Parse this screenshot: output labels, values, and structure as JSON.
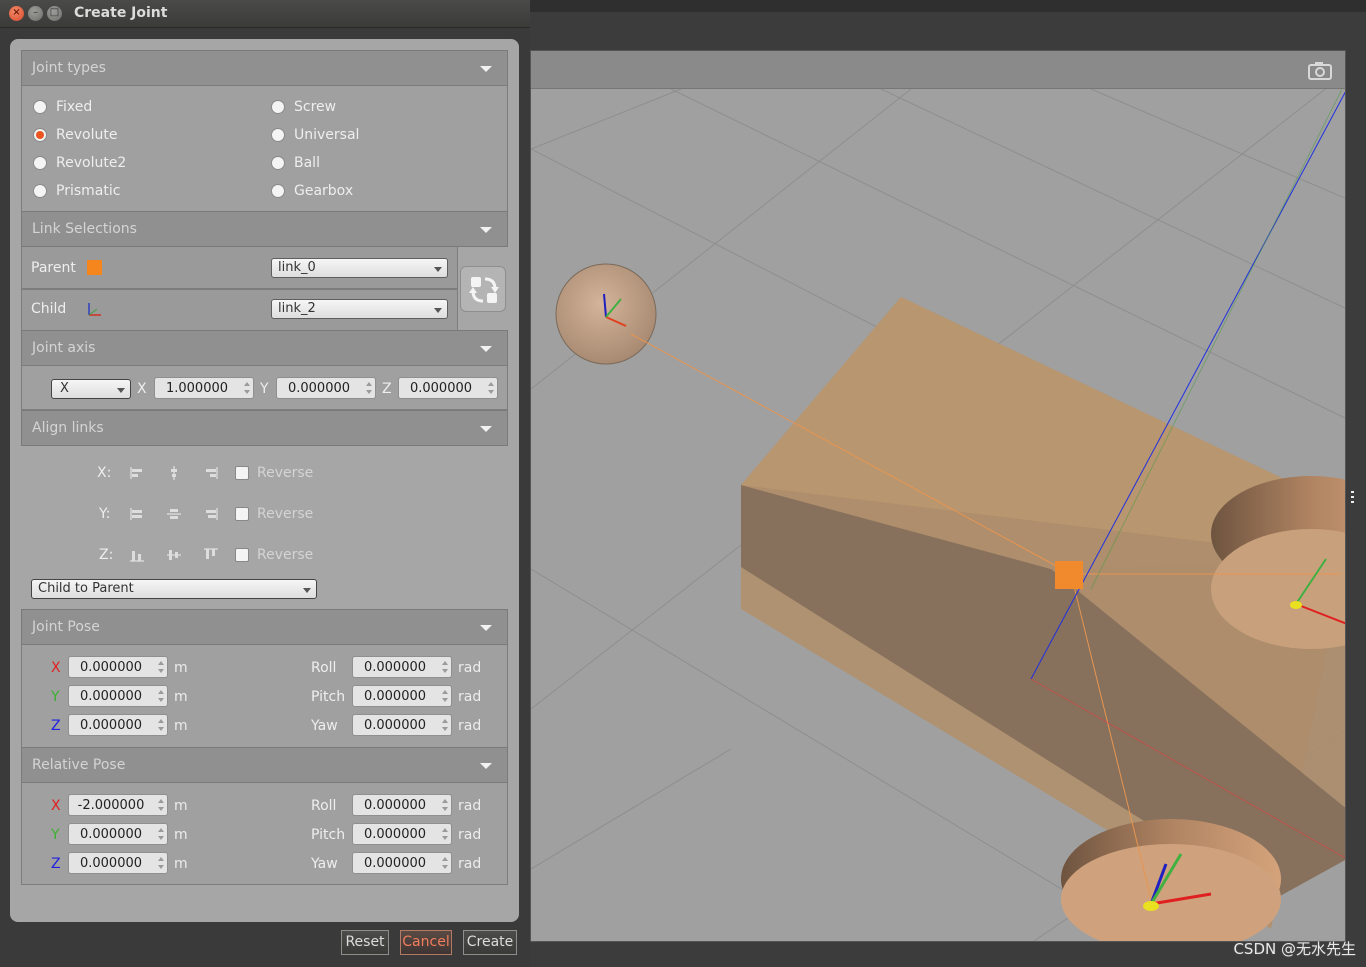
{
  "window": {
    "title": "Create Joint"
  },
  "sections": {
    "joint_types": "Joint types",
    "link_selections": "Link Selections",
    "joint_axis": "Joint axis",
    "align_links": "Align links",
    "joint_pose": "Joint Pose",
    "relative_pose": "Relative Pose"
  },
  "joint_types": [
    {
      "label": "Fixed",
      "checked": false
    },
    {
      "label": "Revolute",
      "checked": true
    },
    {
      "label": "Revolute2",
      "checked": false
    },
    {
      "label": "Prismatic",
      "checked": false
    },
    {
      "label": "Screw",
      "checked": false
    },
    {
      "label": "Universal",
      "checked": false
    },
    {
      "label": "Ball",
      "checked": false
    },
    {
      "label": "Gearbox",
      "checked": false
    }
  ],
  "links": {
    "parent_label": "Parent",
    "parent_value": "link_0",
    "child_label": "Child",
    "child_value": "link_2",
    "parent_color": "#f5861e"
  },
  "axis": {
    "preset": "X",
    "x_label": "X",
    "x": "1.000000",
    "y_label": "Y",
    "y": "0.000000",
    "z_label": "Z",
    "z": "0.000000"
  },
  "align": {
    "x_label": "X:",
    "y_label": "Y:",
    "z_label": "Z:",
    "reverse_label": "Reverse",
    "mode": "Child to Parent"
  },
  "joint_pose": {
    "x_label": "X",
    "x": "0.000000",
    "y_label": "Y",
    "y": "0.000000",
    "z_label": "Z",
    "z": "0.000000",
    "roll_label": "Roll",
    "roll": "0.000000",
    "pitch_label": "Pitch",
    "pitch": "0.000000",
    "yaw_label": "Yaw",
    "yaw": "0.000000",
    "unit_m": "m",
    "unit_rad": "rad"
  },
  "relative_pose": {
    "x_label": "X",
    "x": "-2.000000",
    "y_label": "Y",
    "y": "0.000000",
    "z_label": "Z",
    "z": "0.000000",
    "roll_label": "Roll",
    "roll": "0.000000",
    "pitch_label": "Pitch",
    "pitch": "0.000000",
    "yaw_label": "Yaw",
    "yaw": "0.000000",
    "unit_m": "m",
    "unit_rad": "rad"
  },
  "buttons": {
    "reset": "Reset",
    "cancel": "Cancel",
    "create": "Create"
  },
  "watermark": "CSDN @无水先生",
  "colors": {
    "x_axis": "#e02020",
    "y_axis": "#3cb030",
    "z_axis": "#2020e0",
    "accent": "#e9541f",
    "model": "#c8956a"
  }
}
